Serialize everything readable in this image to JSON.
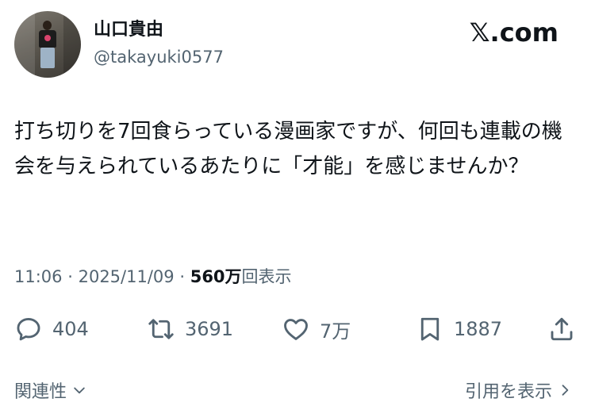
{
  "author": {
    "name": "山口貴由",
    "handle": "@takayuki0577",
    "avatar_icon": "profile-photo"
  },
  "brand": {
    "logo_text": "𝕏.com"
  },
  "tweet": {
    "text": "打ち切りを7回食らっている漫画家ですが、何回も連載の機会を与えられているあたりに「才能」を感じませんか？"
  },
  "meta": {
    "time": "11:06",
    "separator": "·",
    "date": "2025/11/09",
    "views_count": "560万",
    "views_label": "回表示"
  },
  "actions": {
    "reply_count": "404",
    "repost_count": "3691",
    "like_count": "7万",
    "bookmark_count": "1887",
    "icons": [
      "reply-icon",
      "repost-icon",
      "like-icon",
      "bookmark-icon",
      "share-icon"
    ]
  },
  "footer": {
    "related_label": "関連性",
    "quotes_label": "引用を表示"
  },
  "colors": {
    "text": "#0f1419",
    "secondary": "#536471",
    "background": "#ffffff"
  }
}
